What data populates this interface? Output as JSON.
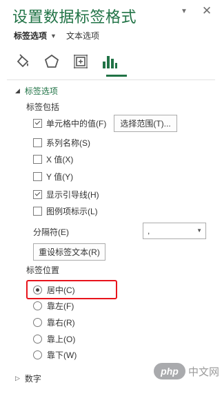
{
  "pane": {
    "title": "设置数据标签格式",
    "tab_label_options": "标签选项",
    "tab_text_options": "文本选项",
    "header_icons": [
      "chevron-down-icon",
      "close-icon"
    ]
  },
  "category_icons": [
    "fill-line-icon",
    "effects-pentagon-icon",
    "size-properties-icon",
    "label-options-chart-icon"
  ],
  "label_options": {
    "section_title": "标签选项",
    "contains_heading": "标签包括",
    "checkboxes": [
      {
        "label": "单元格中的值(F)",
        "checked": true
      },
      {
        "label": "系列名称(S)",
        "checked": false
      },
      {
        "label": "X 值(X)",
        "checked": false
      },
      {
        "label": "Y 值(Y)",
        "checked": false
      },
      {
        "label": "显示引导线(H)",
        "checked": true
      },
      {
        "label": "图例项标示(L)",
        "checked": false
      }
    ],
    "select_range_button": "选择范围(T)...",
    "separator_label": "分隔符(E)",
    "separator_value": ",",
    "reset_button": "重设标签文本(R)",
    "position_heading": "标签位置",
    "positions": [
      {
        "label": "居中(C)",
        "selected": true
      },
      {
        "label": "靠左(F)",
        "selected": false
      },
      {
        "label": "靠右(R)",
        "selected": false
      },
      {
        "label": "靠上(O)",
        "selected": false
      },
      {
        "label": "靠下(W)",
        "selected": false
      }
    ]
  },
  "number_section": {
    "title": "数字"
  },
  "watermark": {
    "badge": "php",
    "text": "中文网"
  },
  "colors": {
    "accent": "#217346",
    "highlight": "#e8131b"
  }
}
